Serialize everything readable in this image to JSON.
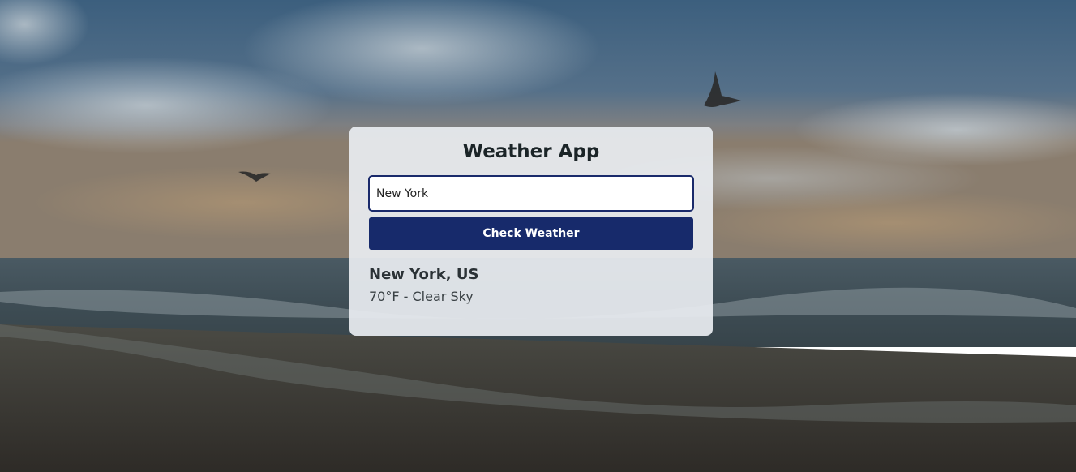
{
  "app": {
    "title": "Weather App"
  },
  "search": {
    "value": "New York",
    "button_label": "Check Weather"
  },
  "result": {
    "location": "New York, US",
    "weather": "70°F - Clear Sky"
  },
  "colors": {
    "accent": "#172a6b",
    "card_background": "#e8ecf0",
    "title_text": "#1b2427"
  },
  "background": {
    "scene": "ocean beach at dusk with seagulls"
  }
}
